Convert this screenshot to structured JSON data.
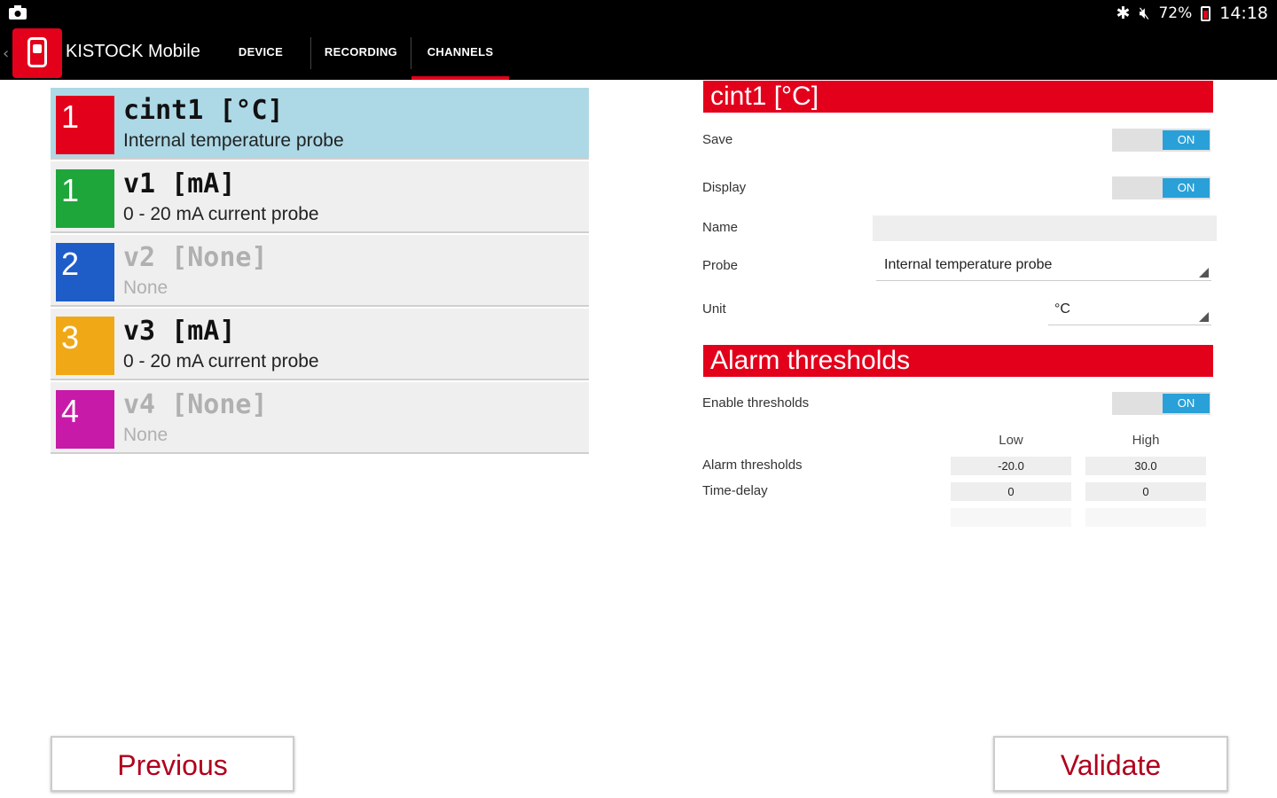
{
  "status_bar": {
    "battery": "72%",
    "time": "14:18"
  },
  "app": {
    "title": "KISTOCK Mobile",
    "tabs": [
      {
        "label": "DEVICE",
        "active": false
      },
      {
        "label": "RECORDING",
        "active": false
      },
      {
        "label": "CHANNELS",
        "active": true
      }
    ]
  },
  "channels": [
    {
      "number": "1",
      "title": "cint1  [°C]",
      "subtitle": "Internal temperature probe",
      "color": "#e3001b",
      "selected": true,
      "enabled": true
    },
    {
      "number": "1",
      "title": "v1  [mA]",
      "subtitle": "0 - 20 mA current probe",
      "color": "#1ea63a",
      "selected": false,
      "enabled": true
    },
    {
      "number": "2",
      "title": "v2  [None]",
      "subtitle": "None",
      "color": "#1e5dc8",
      "selected": false,
      "enabled": false
    },
    {
      "number": "3",
      "title": "v3  [mA]",
      "subtitle": "0 - 20 mA current probe",
      "color": "#f0a817",
      "selected": false,
      "enabled": true
    },
    {
      "number": "4",
      "title": "v4  [None]",
      "subtitle": "None",
      "color": "#c81aa8",
      "selected": false,
      "enabled": false
    }
  ],
  "detail": {
    "header": "cint1  [°C]",
    "save_label": "Save",
    "save_toggle": "ON",
    "display_label": "Display",
    "display_toggle": "ON",
    "name_label": "Name",
    "name_value": "",
    "probe_label": "Probe",
    "probe_value": "Internal temperature probe",
    "unit_label": "Unit",
    "unit_value": "°C"
  },
  "alarms": {
    "header": "Alarm thresholds",
    "enable_label": "Enable thresholds",
    "enable_toggle": "ON",
    "col_low": "Low",
    "col_high": "High",
    "thresholds_label": "Alarm thresholds",
    "thresholds_low": "-20.0",
    "thresholds_high": "30.0",
    "delay_label": "Time-delay",
    "delay_low": "0",
    "delay_high": "0"
  },
  "buttons": {
    "previous": "Previous",
    "validate": "Validate"
  },
  "colors": {
    "accent": "#e3001b",
    "toggle_on": "#2aa0d8",
    "selected_row": "#add8e6",
    "button_text": "#b0001e"
  }
}
